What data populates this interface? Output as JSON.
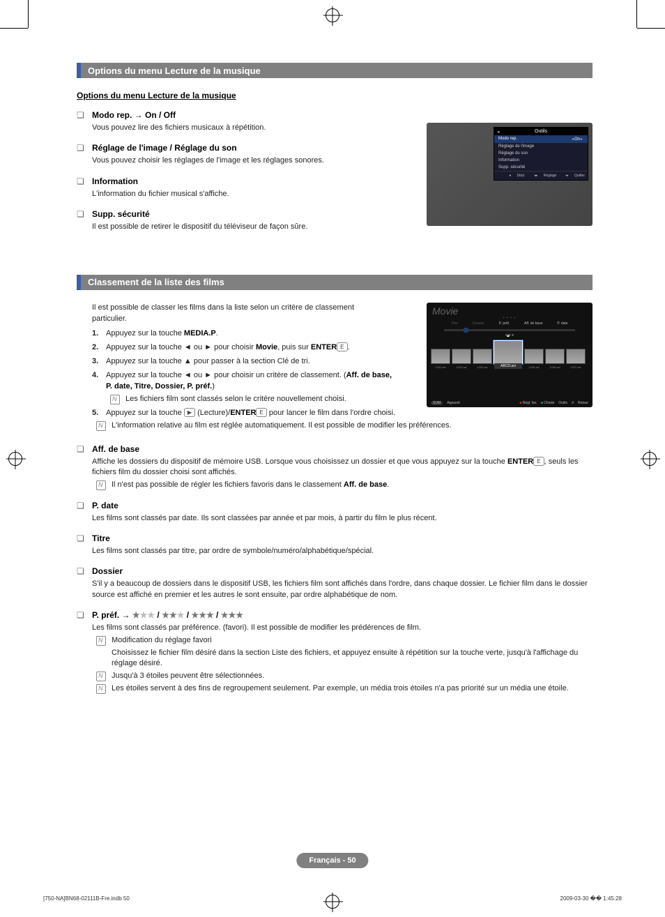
{
  "section1": {
    "title": "Options du menu Lecture de la musique",
    "subtitle": "Options du menu Lecture de la musique",
    "options": [
      {
        "title": "Modo rep. → On / Off",
        "desc": "Vous pouvez lire des fichiers musicaux à répétition."
      },
      {
        "title": "Réglage de l'image / Réglage du son",
        "desc": "Vous pouvez choisir les réglages de l'image et les réglages sonores."
      },
      {
        "title": "Information",
        "desc": "L'information du fichier musical s'affiche."
      },
      {
        "title": "Supp. sécurité",
        "desc": "Il est possible de retirer le dispositif du téléviseur de façon sûre."
      }
    ]
  },
  "screenshot1": {
    "panel_title": "Outils",
    "rows": [
      {
        "label": "Modo rep.",
        "value": "On",
        "selected": true
      },
      {
        "label": "Réglage de l'image",
        "value": "",
        "selected": false
      },
      {
        "label": "Réglage du son",
        "value": "",
        "selected": false
      },
      {
        "label": "Information",
        "value": "",
        "selected": false
      },
      {
        "label": "Supp. sécurité",
        "value": "",
        "selected": false
      }
    ],
    "footer": [
      "Dépl.",
      "Réglage",
      "Quitter"
    ]
  },
  "section2": {
    "title": "Classement de la liste des films",
    "intro": "Il est possible de classer les films dans la liste selon un critère de classement particulier.",
    "steps": {
      "s1a": "Appuyez sur la touche ",
      "s1b": "MEDIA.P",
      "s1c": ".",
      "s2a": "Appuyez sur la touche ◄ ou ► pour choisir ",
      "s2b": "Movie",
      "s2c": ", puis sur ",
      "s2d": "ENTER",
      "s2e": ".",
      "s3": "Appuyez sur la touche ▲ pour passer à la section Clé de tri.",
      "s4a": "Appuyez sur la touche ◄ ou ► pour choisir un critère de classement. (",
      "s4b": "Aff. de base, P. date, Titre, Dossier, P. préf.",
      "s4c": ")",
      "s4note": "Les fichiers film sont classés selon le critère nouvellement choisi.",
      "s5a": "Appuyez sur la touche ",
      "s5b": " (Lecture)/",
      "s5c": "ENTER",
      "s5d": " pour lancer le film dans l'ordre choisi.",
      "s5note": "L'information relative au film est réglée automatiquement. Il est possible de modifier les préférences."
    },
    "options": [
      {
        "title": "Aff. de base",
        "desc": "Affiche les dossiers du dispositif de mémoire USB. Lorsque vous choisissez un dossier et que vous appuyez sur la touche ENTER E, seuls les fichiers film du dossier choisi sont affichés.",
        "note": "Il n'est pas possible de régler les fichiers favoris dans le classement Aff. de base."
      },
      {
        "title": "P. date",
        "desc": "Les films sont classés par date. Ils sont classées par année et par mois, à partir du film le plus récent."
      },
      {
        "title": "Titre",
        "desc": "Les films sont classés par titre, par ordre de symbole/numéro/alphabétique/spécial."
      },
      {
        "title": "Dossier",
        "desc": "S'il y a beaucoup de dossiers dans le dispositif USB, les fichiers film sont affichés dans l'ordre, dans chaque dossier. Le fichier film dans le dossier source est affiché en premier et les autres le sont ensuite, par ordre alphabétique de nom."
      }
    ],
    "pref": {
      "title_prefix": "P. préf. → ",
      "desc": "Les films sont classés par préférence. (favori). Il est possible de modifier les prédérences de film.",
      "note1_title": "Modification du réglage favori",
      "note1_body": "Choisissez le fichier film désiré dans la section Liste des fichiers, et appuyez ensuite à répétition sur la touche verte, jusqu'à l'affichage du réglage désiré.",
      "note2": "Jusqu'à 3 étoiles peuvent être sélectionnées.",
      "note3": "Les étoiles servent à des fins de regroupement seulement. Par exemple, un média trois étoiles n'a pas priorité sur un média une étoile."
    }
  },
  "screenshot2": {
    "head": "Movie",
    "tabs": [
      "Titre",
      "Dossier",
      "P. préf.",
      "Aff. de base",
      "P. date"
    ],
    "thumbs": [
      "1231.avi",
      "1232.avi",
      "1233.avi",
      "ABCD.avi",
      "1235.avi",
      "1236.avi",
      "1237.avi"
    ],
    "selected_index": 3,
    "footer_left": [
      "SUM",
      "Appareil"
    ],
    "footer_right": [
      "Régl. fav.",
      "Choisir",
      "Outils",
      "Retour"
    ]
  },
  "page_footer": "Français - 50",
  "file_footer": "[750-NA]BN68-02111B-Fre.indb   50",
  "time_footer": "2009-03-30   �� 1:45:28"
}
